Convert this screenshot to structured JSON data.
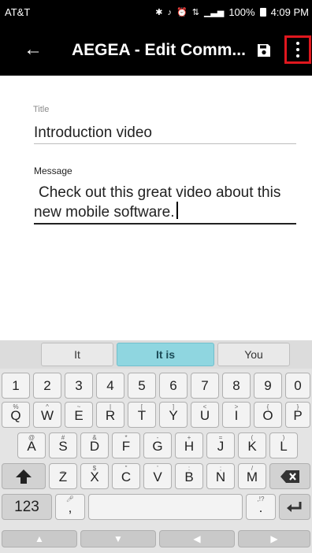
{
  "status_bar": {
    "carrier": "AT&T",
    "icons": [
      "bluetooth-icon",
      "mute-icon",
      "alarm-icon",
      "data-icon",
      "signal-icon"
    ],
    "battery_percent": "100%",
    "time": "4:09 PM"
  },
  "app_bar": {
    "title": "AEGEA - Edit Comm...",
    "back_icon": "arrow-left-icon",
    "save_icon": "save-icon",
    "more_icon": "more-vert-icon",
    "highlight_color": "#e0171e"
  },
  "form": {
    "title_label": "Title",
    "title_value": "Introduction video",
    "message_label": "Message",
    "message_value": "Check out this great video about this new mobile software."
  },
  "keyboard": {
    "suggestions": [
      "It",
      "It is",
      "You"
    ],
    "number_row": [
      "1",
      "2",
      "3",
      "4",
      "5",
      "6",
      "7",
      "8",
      "9",
      "0"
    ],
    "row1": [
      {
        "key": "Q",
        "hint": "%"
      },
      {
        "key": "W",
        "hint": "^"
      },
      {
        "key": "E",
        "hint": "~"
      },
      {
        "key": "R",
        "hint": "|"
      },
      {
        "key": "T",
        "hint": "["
      },
      {
        "key": "Y",
        "hint": "]"
      },
      {
        "key": "U",
        "hint": "<"
      },
      {
        "key": "I",
        "hint": ">"
      },
      {
        "key": "O",
        "hint": "{"
      },
      {
        "key": "P",
        "hint": "}"
      }
    ],
    "row2": [
      {
        "key": "A",
        "hint": "@"
      },
      {
        "key": "S",
        "hint": "#"
      },
      {
        "key": "D",
        "hint": "&"
      },
      {
        "key": "F",
        "hint": "*"
      },
      {
        "key": "G",
        "hint": "-"
      },
      {
        "key": "H",
        "hint": "+"
      },
      {
        "key": "J",
        "hint": "="
      },
      {
        "key": "K",
        "hint": "("
      },
      {
        "key": "L",
        "hint": ")"
      }
    ],
    "row3": [
      {
        "key": "Z",
        "hint": "_"
      },
      {
        "key": "X",
        "hint": "$"
      },
      {
        "key": "C",
        "hint": "\""
      },
      {
        "key": "V",
        "hint": "'"
      },
      {
        "key": "B",
        "hint": ":"
      },
      {
        "key": "N",
        "hint": ";"
      },
      {
        "key": "M",
        "hint": "/"
      }
    ],
    "shift_icon": "shift-arrow-icon",
    "backspace_icon": "backspace-icon",
    "symbols_label": "123",
    "mic_comma_label": ",",
    "punct_label": ".",
    "punct_hint": ",!?",
    "enter_icon": "enter-icon",
    "nav_icons": [
      "nav-up-icon",
      "nav-down-icon",
      "nav-left-icon",
      "nav-right-icon"
    ],
    "suggest_active_color": "#8fd6e0"
  }
}
